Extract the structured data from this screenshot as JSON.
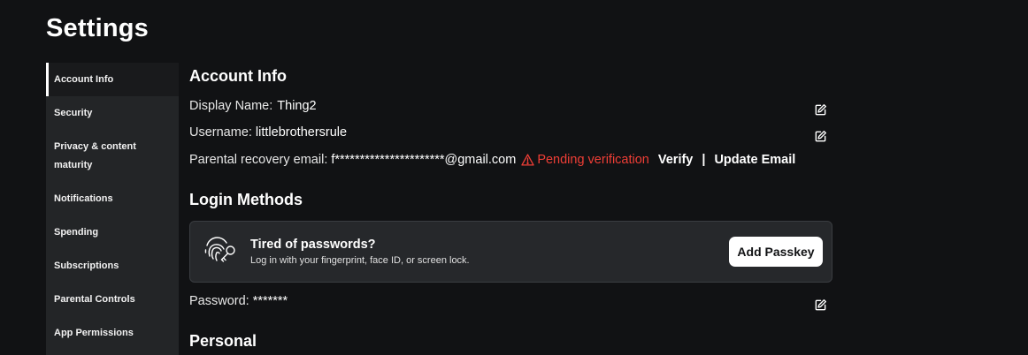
{
  "page": {
    "title": "Settings"
  },
  "sidebar": {
    "items": [
      {
        "label": "Account Info",
        "active": true
      },
      {
        "label": "Security"
      },
      {
        "label": "Privacy & content maturity"
      },
      {
        "label": "Notifications"
      },
      {
        "label": "Spending"
      },
      {
        "label": "Subscriptions"
      },
      {
        "label": "Parental Controls"
      },
      {
        "label": "App Permissions"
      }
    ]
  },
  "account_info": {
    "heading": "Account Info",
    "display_name": {
      "label": "Display Name:",
      "value": "Thing2"
    },
    "username": {
      "label": "Username:",
      "value": "littlebrothersrule"
    },
    "parental_email": {
      "label": "Parental recovery email:",
      "value": "f**********************@gmail.com",
      "status": "Pending verification",
      "verify_label": "Verify",
      "separator": "|",
      "update_label": "Update Email"
    }
  },
  "login_methods": {
    "heading": "Login Methods",
    "passkey": {
      "title": "Tired of passwords?",
      "subtitle": "Log in with your fingerprint, face ID, or screen lock.",
      "button_label": "Add Passkey"
    },
    "password": {
      "label": "Password:",
      "value": "*******"
    }
  },
  "personal": {
    "heading": "Personal"
  },
  "colors": {
    "background": "#111214",
    "sidebar": "#232527",
    "card": "#26282b",
    "warning": "#ef3e36"
  },
  "icons": {
    "edit": "pencil-square-icon",
    "warning": "warning-triangle-icon",
    "passkey": "fingerprint-key-icon"
  }
}
